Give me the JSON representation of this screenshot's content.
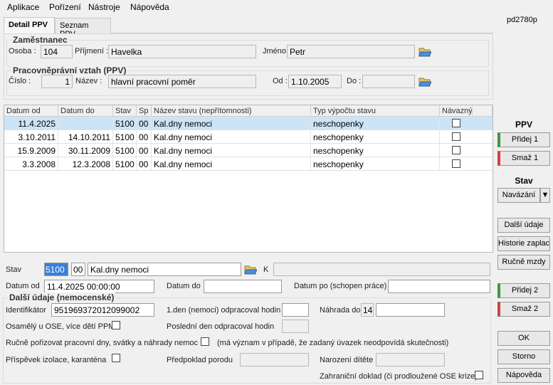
{
  "menu": [
    "Aplikace",
    "Pořízení",
    "Nástroje",
    "Nápověda"
  ],
  "pd_code": "pd2780p",
  "tabs": [
    "Detail PPV",
    "Seznam PPV"
  ],
  "zamestnanec": {
    "title": "Zaměstnanec",
    "osoba_label": "Osoba :",
    "osoba": "104",
    "prijmeni_label": "Příjmení :",
    "prijmeni": "Havelka",
    "jmeno_label": "Jméno :",
    "jmeno": "Petr"
  },
  "ppv": {
    "title": "Pracovněprávní vztah (PPV)",
    "cislo_label": "Číslo :",
    "cislo": "1",
    "nazev_label": "Název :",
    "nazev": "hlavní pracovní poměr",
    "od_label": "Od :",
    "od": "1.10.2005",
    "do_label": "Do :",
    "do": ""
  },
  "table": {
    "headers": [
      "Datum od",
      "Datum do",
      "Stav",
      "Sp",
      "Název stavu (nepřítomnosti)",
      "Typ výpočtu stavu",
      "Návazný"
    ],
    "rows": [
      {
        "od": "11.4.2025",
        "do": "",
        "stav": "5100",
        "sp": "00",
        "nazev": "Kal.dny nemoci",
        "typ": "neschopenky",
        "navazny": false
      },
      {
        "od": "3.10.2011",
        "do": "14.10.2011",
        "stav": "5100",
        "sp": "00",
        "nazev": "Kal.dny nemoci",
        "typ": "neschopenky",
        "navazny": false
      },
      {
        "od": "15.9.2009",
        "do": "30.11.2009",
        "stav": "5100",
        "sp": "00",
        "nazev": "Kal.dny nemoci",
        "typ": "neschopenky",
        "navazny": false
      },
      {
        "od": "3.3.2008",
        "do": "12.3.2008",
        "stav": "5100",
        "sp": "00",
        "nazev": "Kal.dny nemoci",
        "typ": "neschopenky",
        "navazny": false
      }
    ]
  },
  "sidebar": {
    "ppv_title": "PPV",
    "pridej1": "Přidej 1",
    "smaz1": "Smaž 1",
    "stav_title": "Stav",
    "navazani": "Navázání",
    "navazani_arrow": "▼",
    "dalsi_udaje": "Další údaje",
    "historie": "Historie zaplac",
    "rucne_mzdy": "Ručně mzdy",
    "pridej2": "Přidej 2",
    "smaz2": "Smaž 2",
    "ok": "OK",
    "storno": "Storno",
    "napoveda": "Nápověda"
  },
  "detail": {
    "stav_label": "Stav",
    "stav_code": "5100",
    "stav_sp": "00",
    "stav_name": "Kal.dny nemoci",
    "k_label": "K",
    "k_value": "",
    "datum_od_label": "Datum od",
    "datum_od": "11.4.2025 00:00:00",
    "datum_do_label": "Datum do",
    "datum_do": "",
    "datum_po_label": "Datum po (schopen práce)",
    "datum_po": ""
  },
  "dalsi": {
    "title": "Další údaje (nemocenské)",
    "identifikator_label": "Identifikátor",
    "identifikator": "951969372012099002",
    "den1_label": "1.den (nemoci) odpracoval hodin",
    "den1": "",
    "nahrada_label": "Náhrada do",
    "nahrada_num": "14",
    "nahrada": "",
    "osamely_label": "Osamělý u OSE, více dětí PPM",
    "posledni_label": "Poslední den odpracoval hodin",
    "posledni": "",
    "rucne_label": "Ručně pořizovat pracovní dny, svátky a náhrady nemoc",
    "rucne_note": "(má význam v případě, že zadaný úvazek neodpovídá skutečnosti)",
    "prispevek_label": "Příspěvek izolace, karanténa",
    "porod_label": "Předpoklad porodu",
    "porod": "",
    "narozeni_label": "Narození dítěte",
    "narozeni": "",
    "zahranicni_label": "Zahraniční doklad (či prodloužené OSE krize)"
  },
  "colors": {
    "accent": "#3a7fd5",
    "selected_row": "#cce4f7",
    "add": "#3c9a3c",
    "delete": "#d04040"
  }
}
